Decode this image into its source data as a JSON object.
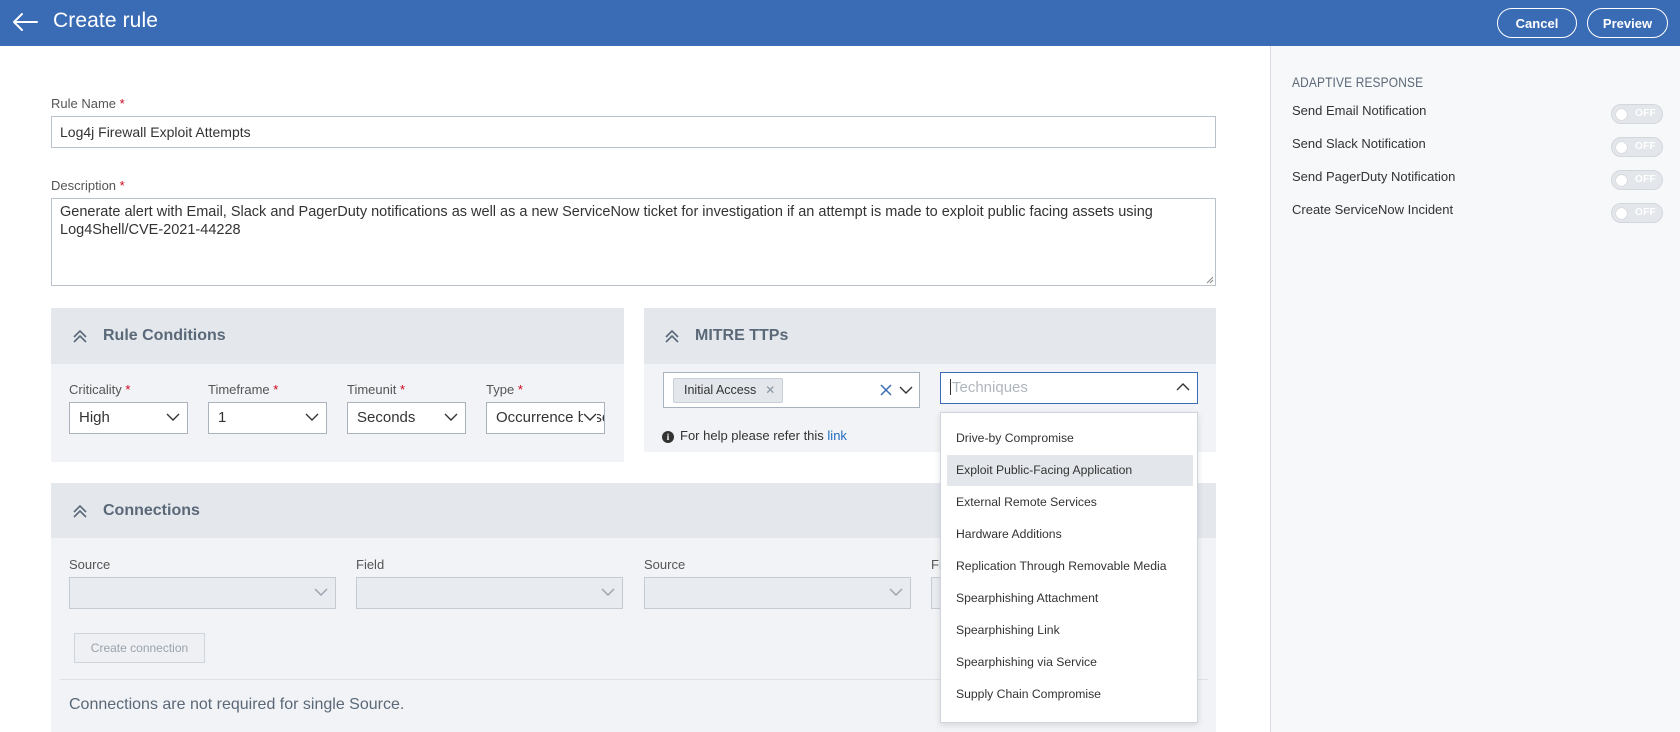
{
  "header": {
    "title": "Create rule",
    "cancel_label": "Cancel",
    "preview_label": "Preview"
  },
  "form": {
    "rule_name_label": "Rule Name",
    "rule_name_value": "Log4j Firewall Exploit Attempts",
    "description_label": "Description",
    "description_value": "Generate alert with Email, Slack and PagerDuty notifications as well as a new ServiceNow ticket for investigation if an attempt is made to exploit public facing assets using Log4Shell/CVE-2021-44228",
    "required_mark": "*"
  },
  "rule_conditions": {
    "title": "Rule Conditions",
    "criticality": {
      "label": "Criticality",
      "value": "High"
    },
    "timeframe": {
      "label": "Timeframe",
      "value": "1"
    },
    "timeunit": {
      "label": "Timeunit",
      "value": "Seconds"
    },
    "type": {
      "label": "Type",
      "value": "Occurrence based"
    }
  },
  "mitre": {
    "title": "MITRE TTPs",
    "selected_tactic": "Initial Access",
    "techniques_placeholder": "Techniques",
    "help_text": "For help please refer this",
    "help_link": "link",
    "technique_options": [
      "Drive-by Compromise",
      "Exploit Public-Facing Application",
      "External Remote Services",
      "Hardware Additions",
      "Replication Through Removable Media",
      "Spearphishing Attachment",
      "Spearphishing Link",
      "Spearphishing via Service",
      "Supply Chain Compromise"
    ],
    "highlighted_option": "Exploit Public-Facing Application"
  },
  "connections": {
    "title": "Connections",
    "source1_label": "Source",
    "field1_label": "Field",
    "source2_label": "Source",
    "field2_label": "Fi",
    "create_button": "Create connection",
    "note": "Connections are not required for single Source."
  },
  "adaptive_response": {
    "title": "ADAPTIVE RESPONSE",
    "items": [
      {
        "label": "Send Email Notification",
        "state": "OFF"
      },
      {
        "label": "Send Slack Notification",
        "state": "OFF"
      },
      {
        "label": "Send PagerDuty Notification",
        "state": "OFF"
      },
      {
        "label": "Create ServiceNow Incident",
        "state": "OFF"
      }
    ]
  },
  "colors": {
    "header": "#3a6bb5",
    "link": "#1f6bbf",
    "required": "#d0021b",
    "panel_title": "#5a6878"
  }
}
